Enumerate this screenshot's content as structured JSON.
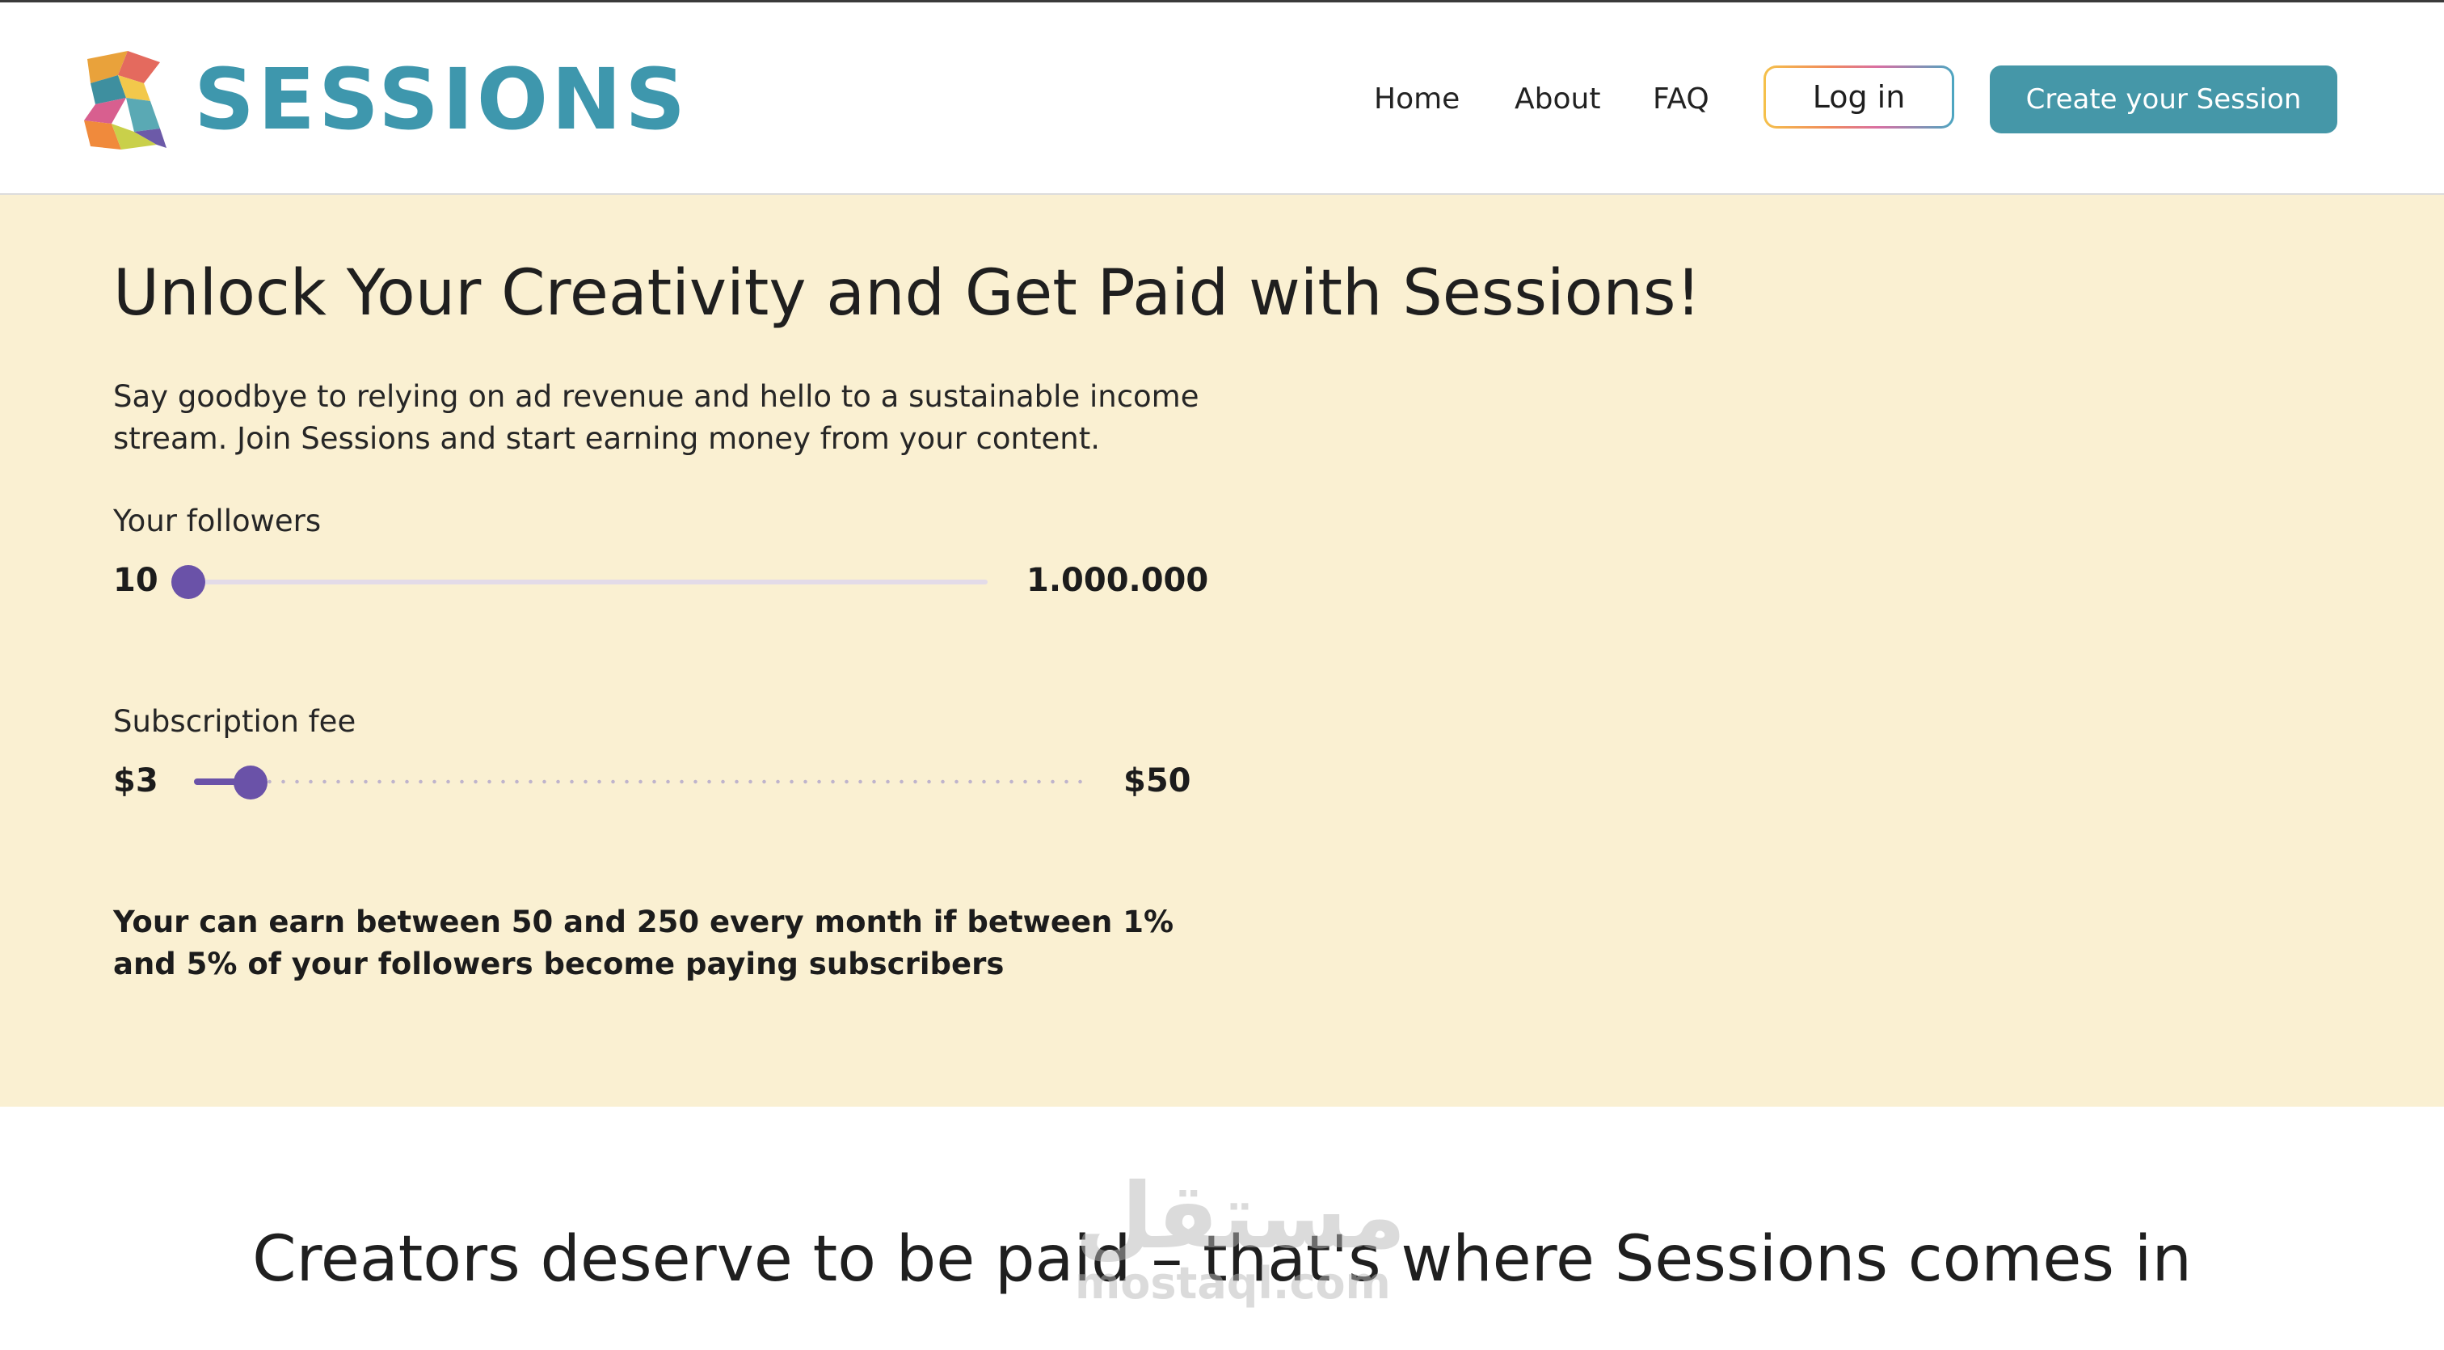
{
  "brand": {
    "name": "SESSIONS",
    "color": "#3e97ad"
  },
  "nav": {
    "items": [
      {
        "label": "Home"
      },
      {
        "label": "About"
      },
      {
        "label": "FAQ"
      }
    ],
    "login_label": "Log in",
    "cta_label": "Create your Session",
    "cta_color": "#4597a8"
  },
  "hero": {
    "background": "#faf0d2",
    "title": "Unlock Your Creativity and Get Paid with Sessions!",
    "description": "Say goodbye to relying on ad revenue and hello to a sustainable income stream. Join Sessions and start earning money from your content.",
    "followers_slider": {
      "label": "Your followers",
      "min_label": "10",
      "max_label": "1.000.000",
      "position": 0.0
    },
    "fee_slider": {
      "label": "Subscription fee",
      "min_label": "$3",
      "max_label": "$50",
      "position": 0.04
    },
    "earnings_text": "Your can earn between 50 and 250 every month if between 1% and 5% of your followers become paying subscribers",
    "slider_color": "#6a52a8"
  },
  "section2": {
    "heading": "Creators deserve to be paid – that's where Sessions comes in"
  },
  "watermark": {
    "arabic": "مستقل",
    "latin": "mostaql.com"
  }
}
